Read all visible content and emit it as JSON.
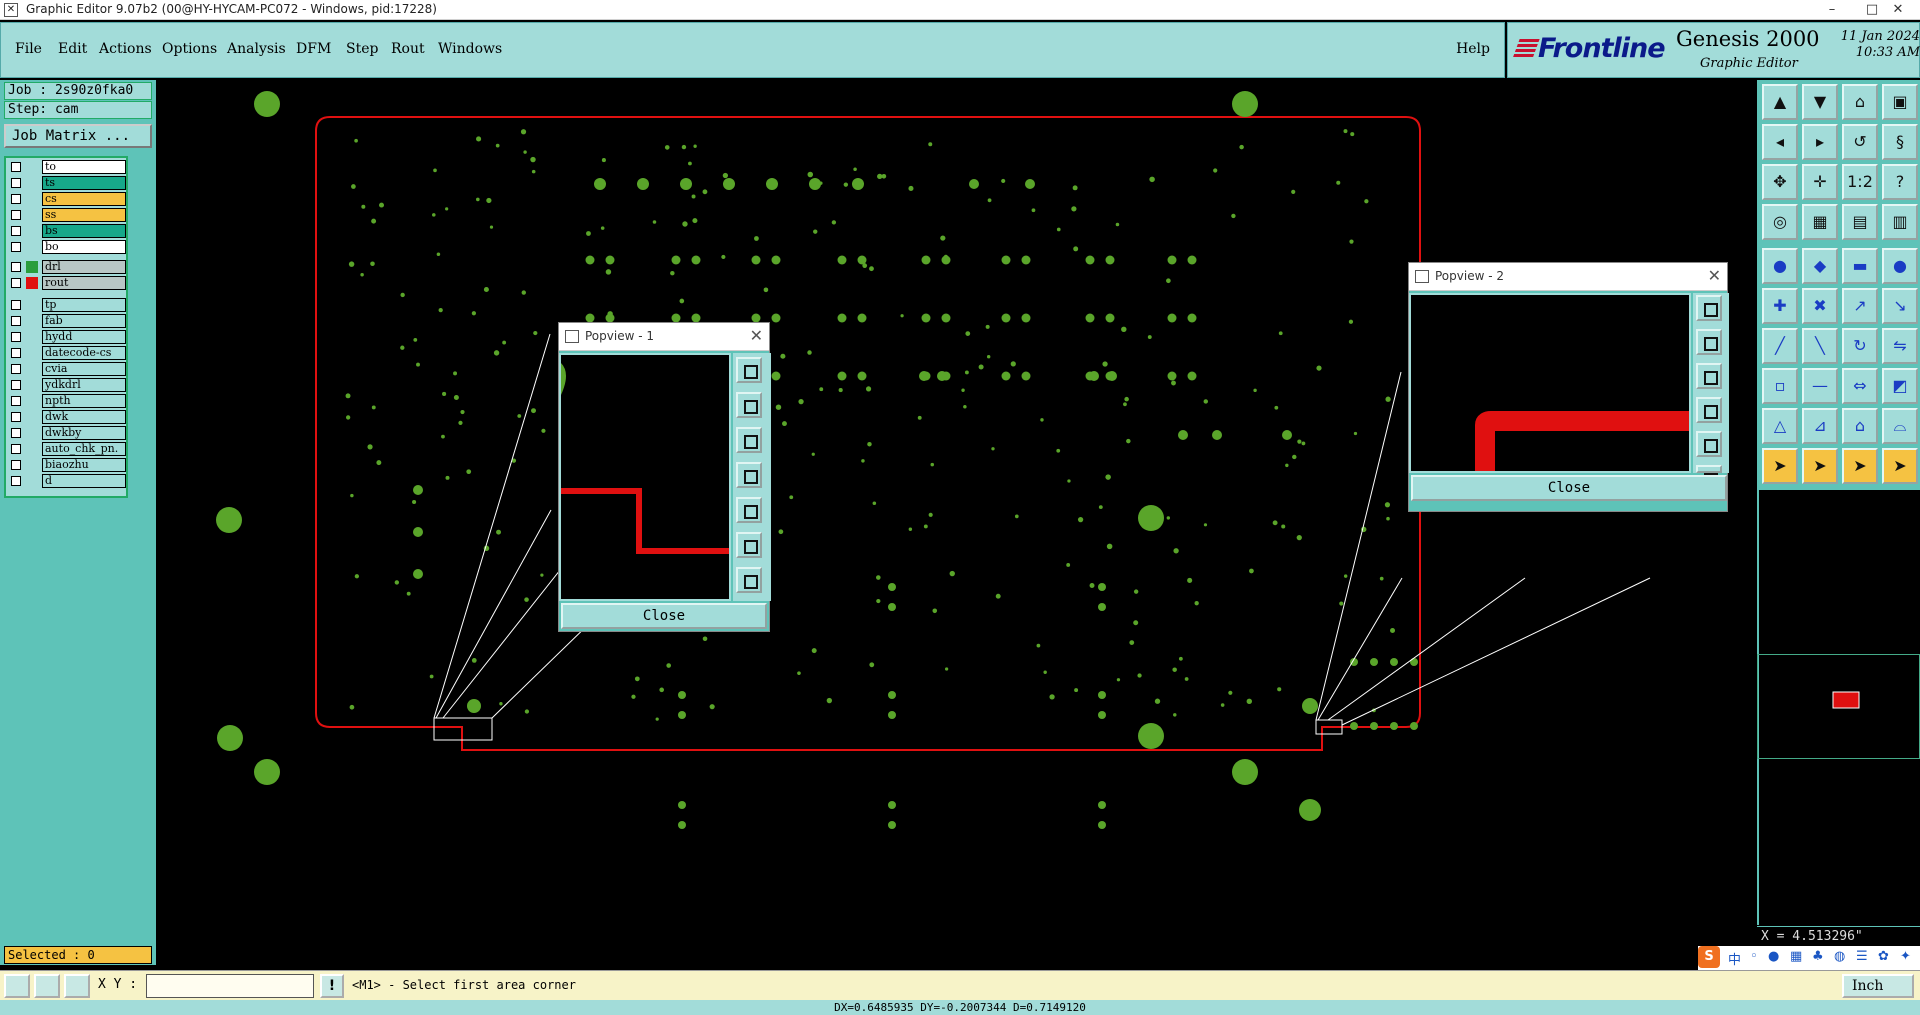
{
  "window": {
    "title": "Graphic Editor 9.07b2 (00@HY-HYCAM-PC072 - Windows, pid:17228)",
    "minimize": "–",
    "maximize": "□",
    "close": "✕"
  },
  "menu": {
    "items": [
      "File",
      "Edit",
      "Actions",
      "Options",
      "Analysis",
      "DFM",
      "Step",
      "Rout",
      "Windows"
    ],
    "help": "Help"
  },
  "brand": {
    "logo": "Frontline",
    "product": "Genesis 2000",
    "subtitle": "Graphic Editor",
    "date": "11 Jan 2024",
    "time": "10:33 AM"
  },
  "job": {
    "job_line": "Job : 2s90z0fka0",
    "step_line": "Step: cam",
    "matrix_button": "Job Matrix ..."
  },
  "layers": [
    {
      "name": "to",
      "color": "#ffffff",
      "swatch": ""
    },
    {
      "name": "ts",
      "color": "#17a88a",
      "swatch": ""
    },
    {
      "name": "cs",
      "color": "#f5c242",
      "swatch": ""
    },
    {
      "name": "ss",
      "color": "#f5c242",
      "swatch": ""
    },
    {
      "name": "bs",
      "color": "#17a88a",
      "swatch": ""
    },
    {
      "name": "bo",
      "color": "#ffffff",
      "swatch": ""
    },
    {
      "name": "drl",
      "color": "#b8c7c5",
      "swatch": "#2a9d3c"
    },
    {
      "name": "rout",
      "color": "#b8c7c5",
      "swatch": "#e01010"
    },
    {
      "name": "tp",
      "color": "#a2dcd9",
      "swatch": ""
    },
    {
      "name": "fab",
      "color": "#a2dcd9",
      "swatch": ""
    },
    {
      "name": "hydd",
      "color": "#a2dcd9",
      "swatch": ""
    },
    {
      "name": "datecode-cs",
      "color": "#a2dcd9",
      "swatch": ""
    },
    {
      "name": "cvia",
      "color": "#a2dcd9",
      "swatch": ""
    },
    {
      "name": "ydkdrl",
      "color": "#a2dcd9",
      "swatch": ""
    },
    {
      "name": "npth",
      "color": "#a2dcd9",
      "swatch": ""
    },
    {
      "name": "dwk",
      "color": "#a2dcd9",
      "swatch": ""
    },
    {
      "name": "dwkby",
      "color": "#a2dcd9",
      "swatch": ""
    },
    {
      "name": "auto_chk_pn.",
      "color": "#a2dcd9",
      "swatch": ""
    },
    {
      "name": "biaozhu",
      "color": "#a2dcd9",
      "swatch": ""
    },
    {
      "name": "d",
      "color": "#a2dcd9",
      "swatch": ""
    }
  ],
  "selected": "Selected : 0",
  "popview1": {
    "title": "Popview - 1",
    "close_label": "Close"
  },
  "popview2": {
    "title": "Popview - 2",
    "close_label": "Close"
  },
  "readout": {
    "x": "X = 4.513296\""
  },
  "status": {
    "xy_label": "X Y :",
    "xy_value": "",
    "excl": "!",
    "prompt": "<M1> - Select first area corner",
    "units": "Inch",
    "bottom": "DX=0.6485935 DY=-0.2007344 D=0.7149120"
  },
  "ime": {
    "s": "S",
    "zh": "中"
  },
  "colors": {
    "panel": "#a2dcd9",
    "panel_dark": "#5ec3b8",
    "pad_green": "#5aa52a",
    "profile_red": "#e01010"
  }
}
